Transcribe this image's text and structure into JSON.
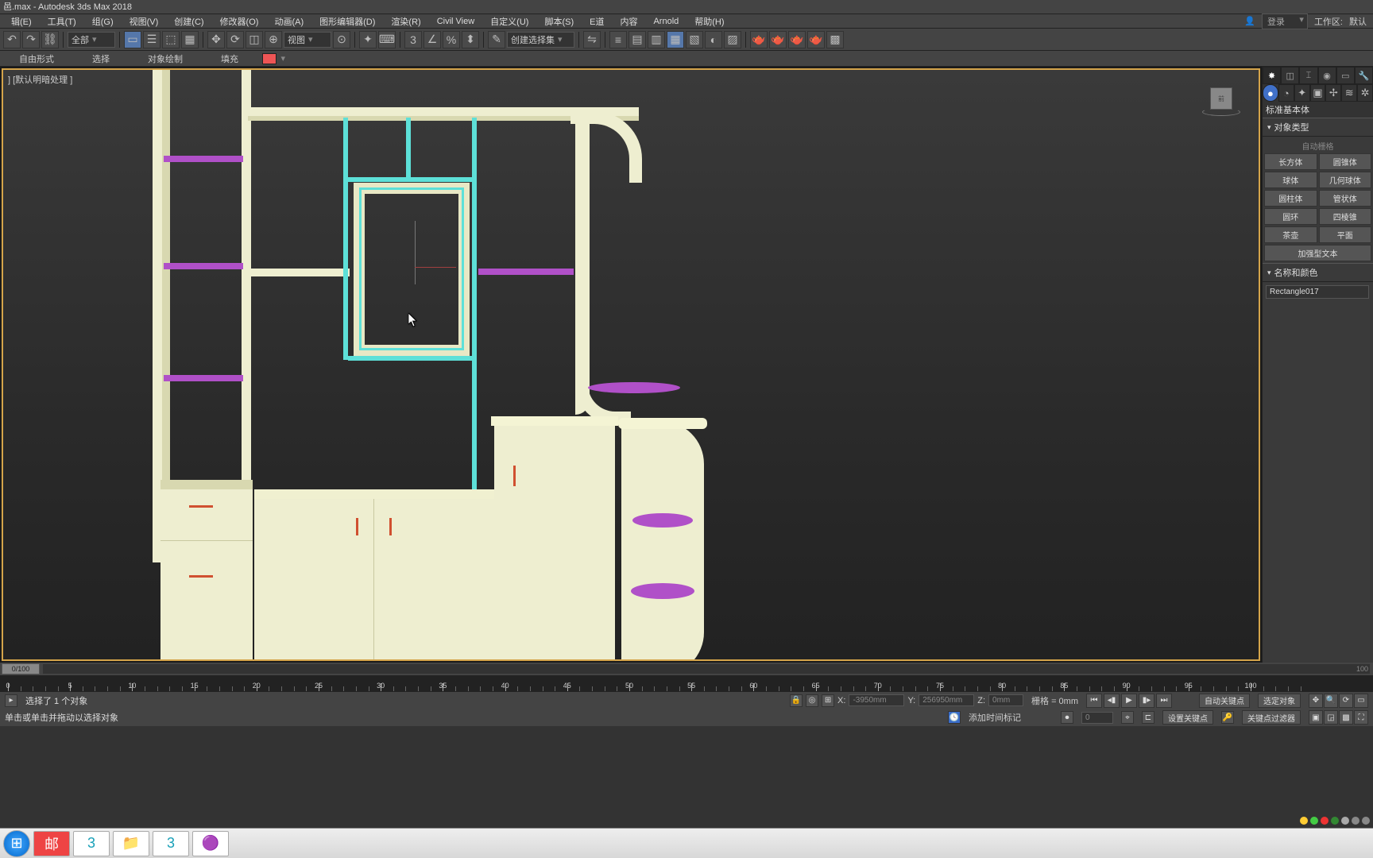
{
  "title": "邑.max - Autodesk 3ds Max 2018",
  "menus": [
    "辑(E)",
    "工具(T)",
    "组(G)",
    "视图(V)",
    "创建(C)",
    "修改器(O)",
    "动画(A)",
    "图形编辑器(D)",
    "渲染(R)",
    "Civil View",
    "自定义(U)",
    "脚本(S)",
    "E道",
    "内容",
    "Arnold",
    "帮助(H)"
  ],
  "login": "登录",
  "workspace_label": "工作区:",
  "workspace_value": "默认",
  "toolbar_dropdowns": {
    "all_filter": "全部",
    "view_label": "视图",
    "selset": "创建选择集"
  },
  "subbar": {
    "freeform": "自由形式",
    "select": "选择",
    "objpaint": "对象绘制",
    "fill": "填充"
  },
  "viewport_label": "] [默认明暗处理 ]",
  "viewcube_face": "前",
  "cmdpanel": {
    "category": "标准基本体",
    "rollouts": {
      "objtype": "对象类型",
      "namecolor": "名称和颜色"
    },
    "autogrid": "自动栅格",
    "primitives": [
      [
        "长方体",
        "圆锥体"
      ],
      [
        "球体",
        "几何球体"
      ],
      [
        "圆柱体",
        "管状体"
      ],
      [
        "圆环",
        "四棱锥"
      ],
      [
        "茶壶",
        "平面"
      ],
      [
        "加强型文本",
        ""
      ]
    ],
    "object_name": "Rectangle017"
  },
  "timeline": {
    "handle": "0/100",
    "end": "100"
  },
  "ruler_majors": [
    0,
    5,
    10,
    15,
    20,
    25,
    30,
    35,
    40,
    45,
    50,
    55,
    60,
    65,
    70,
    75,
    80,
    85,
    90,
    95,
    100
  ],
  "status": {
    "sel": "选择了 1 个对象",
    "prompt": "单击或单击并拖动以选择对象",
    "x_label": "X:",
    "x_val": "-3950mm",
    "y_label": "Y:",
    "y_val": "256950mm",
    "z_label": "Z:",
    "z_val": "0mm",
    "grid_label": "栅格 = 0mm",
    "addtime": "添加时间标记",
    "autokey": "自动关键点",
    "setkey": "设置关键点",
    "selfilter": "选定对象",
    "keyfilter": "关键点过滤器",
    "frame": "0"
  }
}
